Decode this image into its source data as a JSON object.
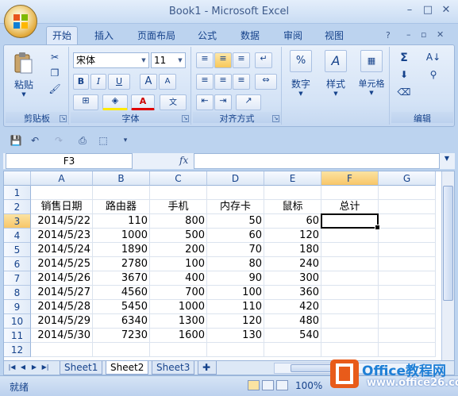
{
  "window": {
    "title": "Book1 - Microsoft Excel"
  },
  "ribbon_tabs": [
    "开始",
    "插入",
    "页面布局",
    "公式",
    "数据",
    "审阅",
    "视图"
  ],
  "active_tab": "开始",
  "clipboard": {
    "paste_label": "粘贴",
    "group_label": "剪贴板"
  },
  "font": {
    "name": "宋体",
    "size": "11",
    "group_label": "字体",
    "bold": "B",
    "italic": "I",
    "underline": "U",
    "grow": "A",
    "shrink": "A",
    "color_a": "A"
  },
  "alignment": {
    "group_label": "对齐方式"
  },
  "number": {
    "label": "数字",
    "symbol": "%"
  },
  "styles": {
    "label": "样式"
  },
  "cells": {
    "label": "单元格"
  },
  "editing": {
    "group_label": "编辑",
    "sum_symbol": "Σ"
  },
  "formula_bar": {
    "name_box": "F3",
    "fx": "fx",
    "value": ""
  },
  "columns": [
    "A",
    "B",
    "C",
    "D",
    "E",
    "F",
    "G"
  ],
  "selected_column": "F",
  "selected_row": 3,
  "rows": [
    {
      "n": "1",
      "cells": [
        "",
        "",
        "",
        "",
        "",
        "",
        ""
      ]
    },
    {
      "n": "2",
      "cells": [
        "销售日期",
        "路由器",
        "手机",
        "内存卡",
        "鼠标",
        "总计",
        ""
      ]
    },
    {
      "n": "3",
      "cells": [
        "2014/5/22",
        "110",
        "800",
        "50",
        "60",
        "",
        ""
      ]
    },
    {
      "n": "4",
      "cells": [
        "2014/5/23",
        "1000",
        "500",
        "60",
        "120",
        "",
        ""
      ]
    },
    {
      "n": "5",
      "cells": [
        "2014/5/24",
        "1890",
        "200",
        "70",
        "180",
        "",
        ""
      ]
    },
    {
      "n": "6",
      "cells": [
        "2014/5/25",
        "2780",
        "100",
        "80",
        "240",
        "",
        ""
      ]
    },
    {
      "n": "7",
      "cells": [
        "2014/5/26",
        "3670",
        "400",
        "90",
        "300",
        "",
        ""
      ]
    },
    {
      "n": "8",
      "cells": [
        "2014/5/27",
        "4560",
        "700",
        "100",
        "360",
        "",
        ""
      ]
    },
    {
      "n": "9",
      "cells": [
        "2014/5/28",
        "5450",
        "1000",
        "110",
        "420",
        "",
        ""
      ]
    },
    {
      "n": "10",
      "cells": [
        "2014/5/29",
        "6340",
        "1300",
        "120",
        "480",
        "",
        ""
      ]
    },
    {
      "n": "11",
      "cells": [
        "2014/5/30",
        "7230",
        "1600",
        "130",
        "540",
        "",
        ""
      ]
    },
    {
      "n": "12",
      "cells": [
        "",
        "",
        "",
        "",
        "",
        "",
        ""
      ]
    }
  ],
  "sheets": [
    "Sheet1",
    "Sheet2",
    "Sheet3"
  ],
  "active_sheet": "Sheet2",
  "status": {
    "ready": "就绪",
    "zoom": "100%"
  },
  "watermark": {
    "brand": "Office教程网",
    "site": "www.office26.com"
  }
}
